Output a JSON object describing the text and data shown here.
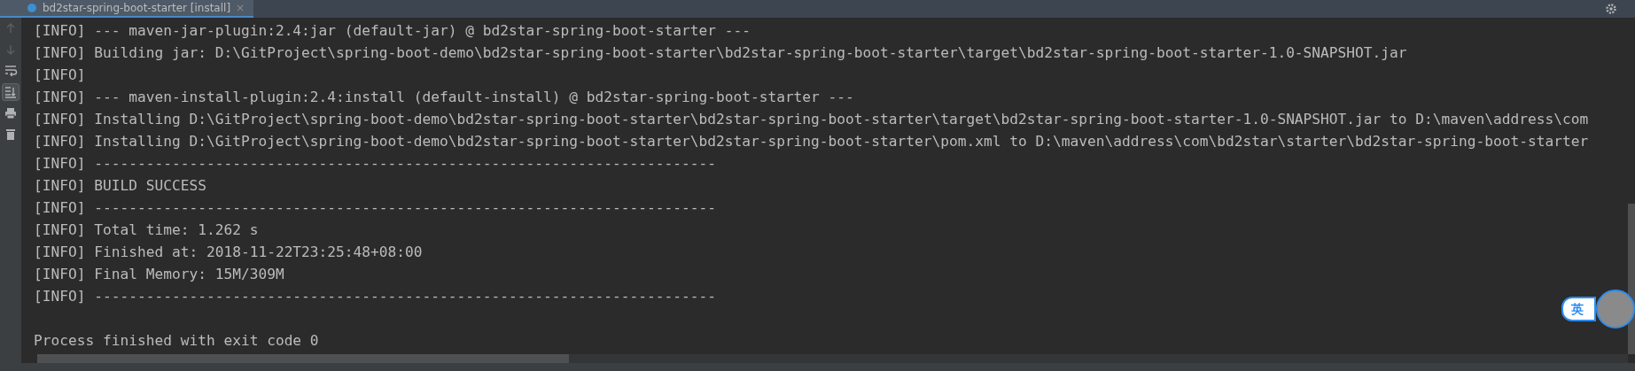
{
  "tab": {
    "label": "bd2star-spring-boot-starter [install]",
    "close": "×",
    "selected": true
  },
  "toolbar": [
    {
      "kind": "up",
      "disabled": true,
      "selected": false
    },
    {
      "kind": "down",
      "disabled": true,
      "selected": false
    },
    {
      "kind": "wrap",
      "disabled": false,
      "selected": false
    },
    {
      "kind": "scroll-end",
      "disabled": false,
      "selected": true
    },
    {
      "kind": "print",
      "disabled": false,
      "selected": false
    },
    {
      "kind": "trash",
      "disabled": false,
      "selected": false
    }
  ],
  "console": {
    "lines": [
      "[INFO] --- maven-jar-plugin:2.4:jar (default-jar) @ bd2star-spring-boot-starter ---",
      "[INFO] Building jar: D:\\GitProject\\spring-boot-demo\\bd2star-spring-boot-starter\\bd2star-spring-boot-starter\\target\\bd2star-spring-boot-starter-1.0-SNAPSHOT.jar",
      "[INFO]",
      "[INFO] --- maven-install-plugin:2.4:install (default-install) @ bd2star-spring-boot-starter ---",
      "[INFO] Installing D:\\GitProject\\spring-boot-demo\\bd2star-spring-boot-starter\\bd2star-spring-boot-starter\\target\\bd2star-spring-boot-starter-1.0-SNAPSHOT.jar to D:\\maven\\address\\com",
      "[INFO] Installing D:\\GitProject\\spring-boot-demo\\bd2star-spring-boot-starter\\bd2star-spring-boot-starter\\pom.xml to D:\\maven\\address\\com\\bd2star\\starter\\bd2star-spring-boot-starter",
      "[INFO] ------------------------------------------------------------------------",
      "[INFO] BUILD SUCCESS",
      "[INFO] ------------------------------------------------------------------------",
      "[INFO] Total time: 1.262 s",
      "[INFO] Finished at: 2018-11-22T23:25:48+08:00",
      "[INFO] Final Memory: 15M/309M",
      "[INFO] ------------------------------------------------------------------------"
    ],
    "exit_message": "Process finished with exit code 0"
  },
  "ime_badge": {
    "label": "英"
  }
}
